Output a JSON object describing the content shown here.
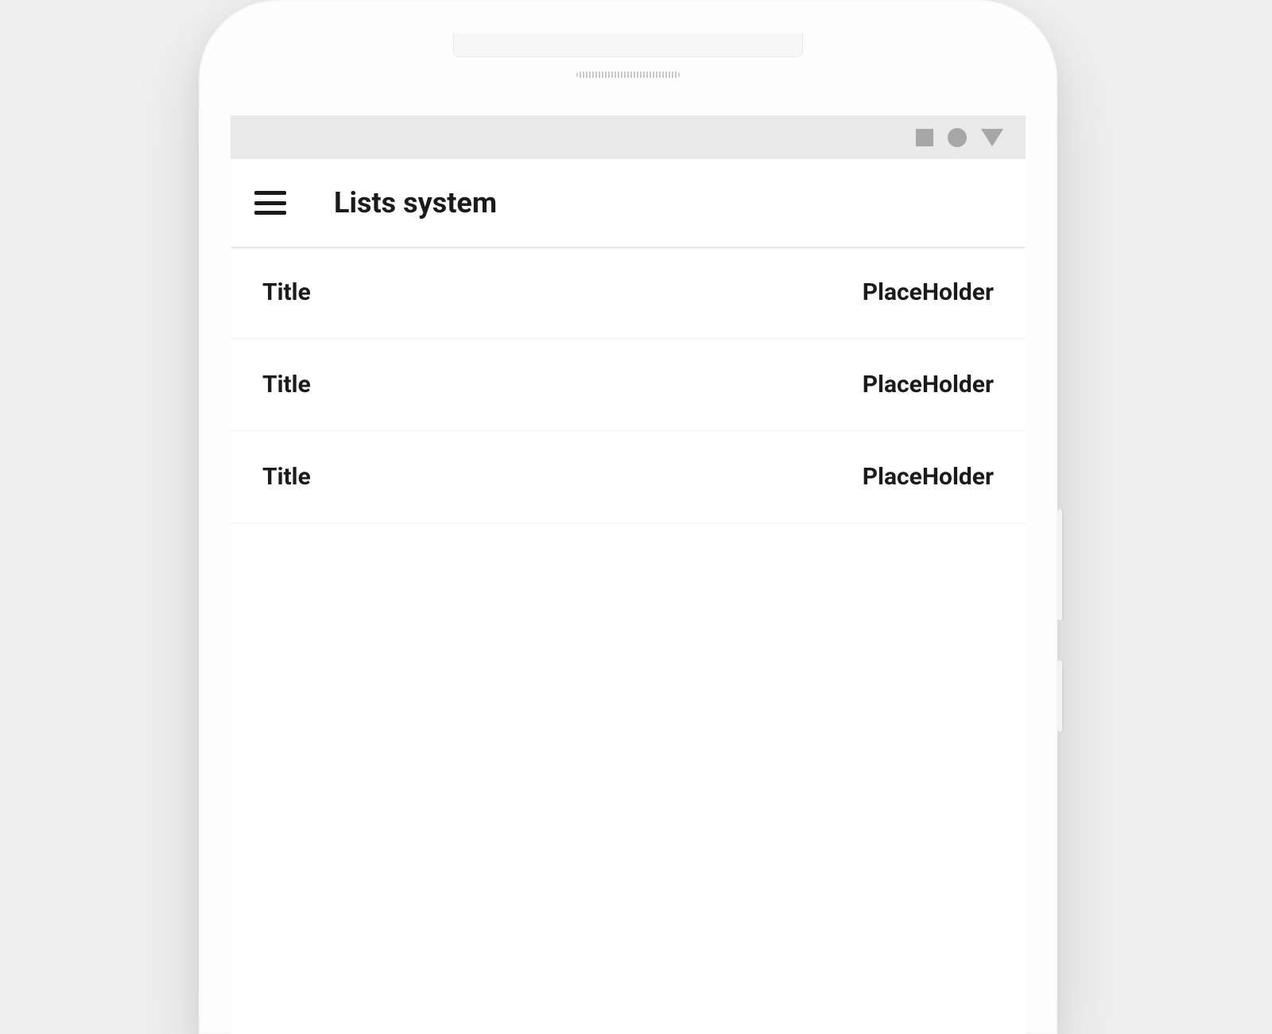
{
  "appbar": {
    "title": "Lists system"
  },
  "list": {
    "items": [
      {
        "title": "Title",
        "placeholder": "PlaceHolder"
      },
      {
        "title": "Title",
        "placeholder": "PlaceHolder"
      },
      {
        "title": "Title",
        "placeholder": "PlaceHolder"
      }
    ]
  }
}
